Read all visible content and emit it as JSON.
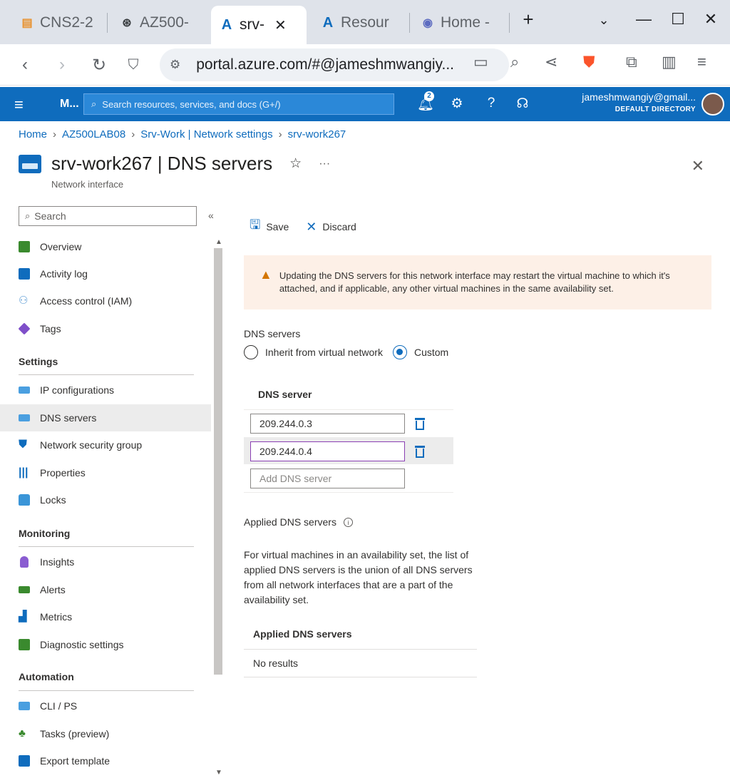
{
  "browser": {
    "tabs": [
      {
        "title": "CNS2-2",
        "icon": "folder-icon"
      },
      {
        "title": "AZ500-",
        "icon": "openai-icon"
      },
      {
        "title": "srv-",
        "icon": "azure-icon",
        "active": true
      },
      {
        "title": "Resour",
        "icon": "azure-icon"
      },
      {
        "title": "Home -",
        "icon": "chatgpt-icon"
      }
    ],
    "new_tab": "+",
    "url": "portal.azure.com/#@jameshmwangiy..."
  },
  "azure": {
    "brand": "M...",
    "search_placeholder": "Search resources, services, and docs (G+/)",
    "notification_count": "2",
    "user_email": "jameshmwangiy@gmail...",
    "directory": "DEFAULT DIRECTORY"
  },
  "breadcrumb": [
    "Home",
    "AZ500LAB08",
    "Srv-Work | Network settings",
    "srv-work267"
  ],
  "page": {
    "title": "srv-work267 | DNS servers",
    "subtitle": "Network interface"
  },
  "nav": {
    "search_placeholder": "Search",
    "items_top": [
      {
        "label": "Overview",
        "icon": "overview-icon",
        "color": "#3a8a2e"
      },
      {
        "label": "Activity log",
        "icon": "activity-log-icon",
        "color": "#0f6cbd"
      },
      {
        "label": "Access control (IAM)",
        "icon": "people-icon",
        "color": "#5b9bd5"
      },
      {
        "label": "Tags",
        "icon": "tag-icon",
        "color": "#7f4fc9"
      }
    ],
    "settings_heading": "Settings",
    "items_settings": [
      {
        "label": "IP configurations",
        "icon": "ip-config-icon",
        "color": "#4a9fe0"
      },
      {
        "label": "DNS servers",
        "icon": "dns-icon",
        "color": "#4a9fe0",
        "active": true
      },
      {
        "label": "Network security group",
        "icon": "shield-icon",
        "color": "#0f6cbd"
      },
      {
        "label": "Properties",
        "icon": "properties-icon",
        "color": "#0f6cbd"
      },
      {
        "label": "Locks",
        "icon": "lock-icon",
        "color": "#3a95d8"
      }
    ],
    "monitoring_heading": "Monitoring",
    "items_monitoring": [
      {
        "label": "Insights",
        "icon": "lightbulb-icon",
        "color": "#8a5cd1"
      },
      {
        "label": "Alerts",
        "icon": "alerts-icon",
        "color": "#3a8a2e"
      },
      {
        "label": "Metrics",
        "icon": "metrics-icon",
        "color": "#0f6cbd"
      },
      {
        "label": "Diagnostic settings",
        "icon": "diagnostic-icon",
        "color": "#3a8a2e"
      }
    ],
    "automation_heading": "Automation",
    "items_automation": [
      {
        "label": "CLI / PS",
        "icon": "cli-icon",
        "color": "#4a9fe0"
      },
      {
        "label": "Tasks (preview)",
        "icon": "tasks-icon",
        "color": "#3a8a2e"
      },
      {
        "label": "Export template",
        "icon": "export-icon",
        "color": "#0f6cbd"
      }
    ]
  },
  "commands": {
    "save": "Save",
    "discard": "Discard"
  },
  "warning": "Updating the DNS servers for this network interface may restart the virtual machine to which it's attached, and if applicable, any other virtual machines in the same availability set.",
  "dns": {
    "section_label": "DNS servers",
    "option_inherit": "Inherit from virtual network",
    "option_custom": "Custom",
    "grid_header": "DNS server",
    "servers": [
      "209.244.0.3",
      "209.244.0.4"
    ],
    "add_placeholder": "Add DNS server"
  },
  "applied": {
    "label": "Applied DNS servers",
    "description": "For virtual machines in an availability set, the list of applied DNS servers is the union of all DNS servers from all network interfaces that are a part of the availability set.",
    "table_header": "Applied DNS servers",
    "empty_text": "No results"
  }
}
